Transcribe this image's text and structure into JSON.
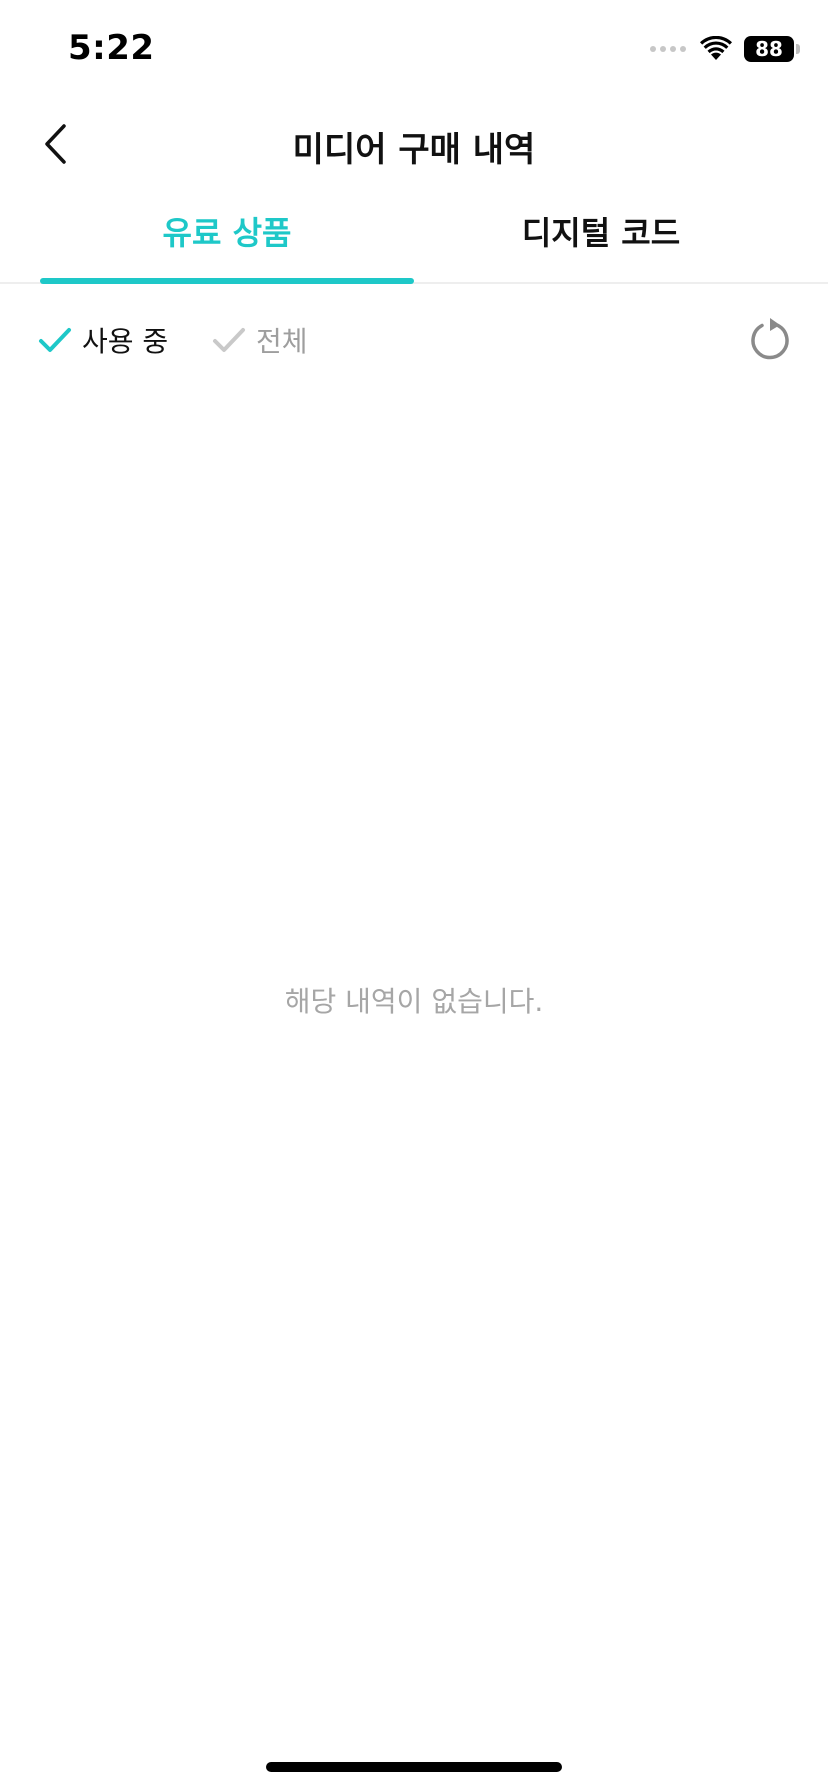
{
  "status_bar": {
    "time": "5:22",
    "battery_level": "88",
    "icons": [
      "signal-dots-icon",
      "wifi-icon",
      "battery-icon"
    ]
  },
  "header": {
    "title": "미디어 구매 내역",
    "back_icon": "chevron-left-icon"
  },
  "tabs": [
    {
      "label": "유료 상품",
      "active": true
    },
    {
      "label": "디지털 코드",
      "active": false
    }
  ],
  "filters": {
    "in_use": {
      "label": "사용 중",
      "checked": true
    },
    "all": {
      "label": "전체",
      "checked": false
    },
    "refresh_icon": "refresh-icon"
  },
  "empty_state": {
    "message": "해당 내역이 없습니다."
  },
  "colors": {
    "accent": "#1ec8c8",
    "text_primary": "#111111",
    "text_inactive": "#9e9e9e",
    "empty_text": "#a6a6a6",
    "icon_gray": "#8a8a8a"
  }
}
